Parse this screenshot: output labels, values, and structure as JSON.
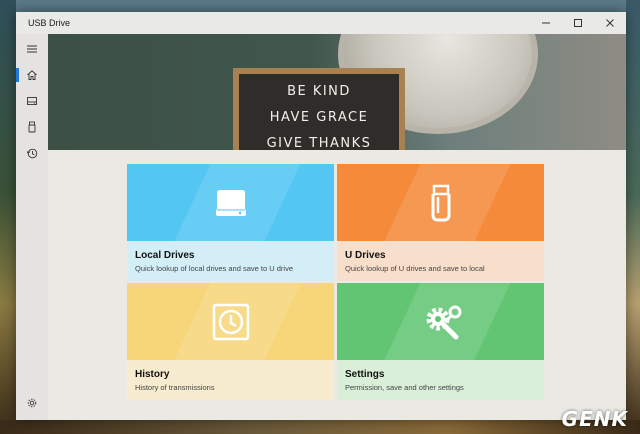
{
  "window": {
    "title": "USB Drive"
  },
  "sidebar": {
    "items": [
      {
        "name": "menu",
        "icon": "hamburger-icon"
      },
      {
        "name": "home",
        "icon": "home-icon",
        "active": true
      },
      {
        "name": "local-drives",
        "icon": "drive-icon"
      },
      {
        "name": "u-drives",
        "icon": "usb-icon"
      },
      {
        "name": "history",
        "icon": "history-icon"
      },
      {
        "name": "settings",
        "icon": "gear-icon"
      }
    ]
  },
  "hero": {
    "board_lines": [
      "BE KIND",
      "HAVE GRACE",
      "GIVE THANKS"
    ]
  },
  "tiles": [
    {
      "title": "Local Drives",
      "subtitle": "Quick lookup of local drives and save to U drive",
      "icon": "drive-icon",
      "color_top": "#53c6f4",
      "color_bottom": "#d4eef7"
    },
    {
      "title": "U Drives",
      "subtitle": "Quick lookup of U drives and save to local",
      "icon": "usb-icon",
      "color_top": "#f48a3a",
      "color_bottom": "#f8dfcc"
    },
    {
      "title": "History",
      "subtitle": "History of transmissions",
      "icon": "clock-icon",
      "color_top": "#f7d67a",
      "color_bottom": "#f7ecd0"
    },
    {
      "title": "Settings",
      "subtitle": "Permission, save and other settings",
      "icon": "gear-wrench-icon",
      "color_top": "#62c573",
      "color_bottom": "#d9efd8"
    }
  ],
  "colors": {
    "accent": "#1e78d8"
  },
  "watermark": "GENK"
}
